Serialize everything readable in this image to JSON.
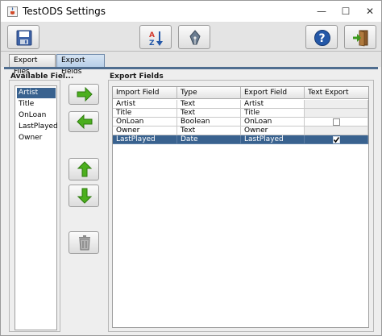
{
  "window": {
    "title": "TestODS Settings",
    "minimize_glyph": "—",
    "maximize_glyph": "☐",
    "close_glyph": "✕"
  },
  "toolbar": {
    "buttons": [
      {
        "icon": "save-icon"
      },
      {
        "icon": "sort-az-icon"
      },
      {
        "icon": "pen-nib-icon"
      },
      {
        "icon": "help-icon"
      },
      {
        "icon": "exit-door-icon"
      }
    ]
  },
  "tabs": [
    {
      "label": "Export Files",
      "active": false
    },
    {
      "label": "Export Fields",
      "active": true
    }
  ],
  "available_fields": {
    "title": "Available Fiel...",
    "items": [
      "Artist",
      "Title",
      "OnLoan",
      "LastPlayed",
      "Owner"
    ],
    "selected_index": 0
  },
  "side_buttons": [
    {
      "icon": "arrow-right-icon"
    },
    {
      "icon": "arrow-left-icon"
    },
    {
      "icon": "arrow-up-icon"
    },
    {
      "icon": "arrow-down-icon"
    },
    {
      "icon": "trash-icon"
    }
  ],
  "export_fields": {
    "title": "Export Fields",
    "columns": [
      "Import Field",
      "Type",
      "Export Field",
      "Text Export"
    ],
    "rows": [
      {
        "import": "Artist",
        "type": "Text",
        "export": "Artist",
        "text_export": null
      },
      {
        "import": "Title",
        "type": "Text",
        "export": "Title",
        "text_export": null
      },
      {
        "import": "OnLoan",
        "type": "Boolean",
        "export": "OnLoan",
        "text_export": false
      },
      {
        "import": "Owner",
        "type": "Text",
        "export": "Owner",
        "text_export": null
      },
      {
        "import": "LastPlayed",
        "type": "Date",
        "export": "LastPlayed",
        "text_export": true
      }
    ],
    "selected_index": 4
  },
  "colors": {
    "selection": "#39628f",
    "arrow_green": "#4caf1e",
    "help_blue": "#2458a8"
  }
}
